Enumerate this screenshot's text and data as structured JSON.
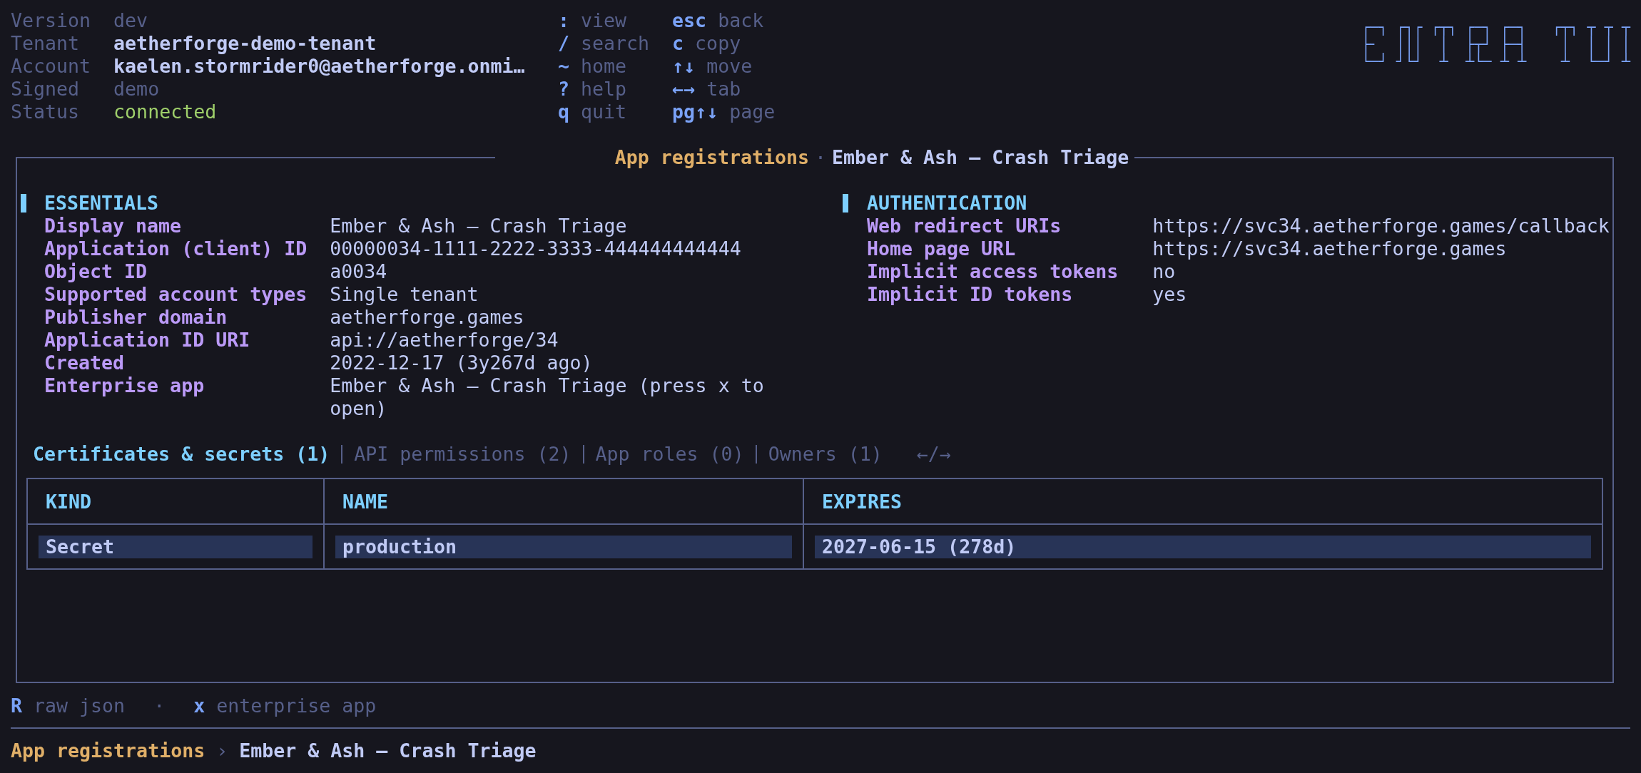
{
  "header": {
    "info": [
      {
        "label": "Version",
        "value": "dev",
        "kind": "muted"
      },
      {
        "label": "Tenant",
        "value": "aetherforge-demo-tenant",
        "kind": "strong"
      },
      {
        "label": "Account",
        "value": "kaelen.stormrider0@aetherforge.onmi…",
        "kind": "strong"
      },
      {
        "label": "Signed",
        "value": "demo",
        "kind": "muted"
      },
      {
        "label": "Status",
        "value": "connected",
        "kind": "ok"
      }
    ],
    "keybindings": [
      {
        "key": ":",
        "action": "view"
      },
      {
        "key": "/",
        "action": "search"
      },
      {
        "key": "~",
        "action": "home"
      },
      {
        "key": "?",
        "action": "help"
      },
      {
        "key": "q",
        "action": "quit"
      },
      {
        "key": "esc",
        "action": "back"
      },
      {
        "key": "c",
        "action": "copy"
      },
      {
        "key": "↑↓",
        "action": "move"
      },
      {
        "key": "←→",
        "action": "tab"
      },
      {
        "key": "pg↑↓",
        "action": "page"
      }
    ],
    "logo_lines": [
      "┌─┐ ┌┐┌ ┌┬┐ ┌─┐ ┌─┐   ┌┬┐ ┬ ┬ ┬",
      "├╴  │││  │  ├┬┘ ├─┤    │  │ │ │",
      "└─┘ ┘└┘  ┴  ┴└─ ┴ ┴    ┴  └─┘ ┴"
    ]
  },
  "panel": {
    "title": {
      "section": "App registrations",
      "separator": "·",
      "item": "Ember & Ash — Crash Triage"
    },
    "sections": [
      {
        "heading": "ESSENTIALS",
        "fields": [
          {
            "label": "Display name",
            "value": "Ember & Ash — Crash Triage"
          },
          {
            "label": "Application (client) ID",
            "value": "00000034-1111-2222-3333-444444444444"
          },
          {
            "label": "Object ID",
            "value": "a0034"
          },
          {
            "label": "Supported account types",
            "value": "Single tenant"
          },
          {
            "label": "Publisher domain",
            "value": "aetherforge.games"
          },
          {
            "label": "Application ID URI",
            "value": "api://aetherforge/34"
          },
          {
            "label": "Created",
            "value": "2022-12-17 (3y267d ago)"
          },
          {
            "label": "Enterprise app",
            "value": "Ember & Ash — Crash Triage (press x to open)"
          }
        ]
      },
      {
        "heading": "AUTHENTICATION",
        "fields": [
          {
            "label": "Web redirect URIs",
            "value": "https://svc34.aetherforge.games/callback"
          },
          {
            "label": "Home page URL",
            "value": "https://svc34.aetherforge.games"
          },
          {
            "label": "Implicit access tokens",
            "value": "no"
          },
          {
            "label": "Implicit ID tokens",
            "value": "yes"
          }
        ]
      }
    ],
    "tabs": [
      {
        "label": "Certificates & secrets (1)",
        "selected": true
      },
      {
        "label": "API permissions (2)",
        "selected": false
      },
      {
        "label": "App roles (0)",
        "selected": false
      },
      {
        "label": "Owners (1)",
        "selected": false
      }
    ],
    "tabs_hint": "←/→",
    "table": {
      "columns": [
        "KIND",
        "NAME",
        "EXPIRES"
      ],
      "rows": [
        {
          "cells": [
            "Secret",
            "production",
            "2027-06-15 (278d)"
          ],
          "selected": true
        }
      ]
    }
  },
  "footer": {
    "hints": [
      {
        "key": "R",
        "action": "raw json"
      },
      {
        "key": "x",
        "action": "enterprise app"
      }
    ],
    "separator": "·"
  },
  "breadcrumb": {
    "items": [
      "App registrations",
      "Ember & Ash — Crash Triage"
    ],
    "separator": "›"
  }
}
